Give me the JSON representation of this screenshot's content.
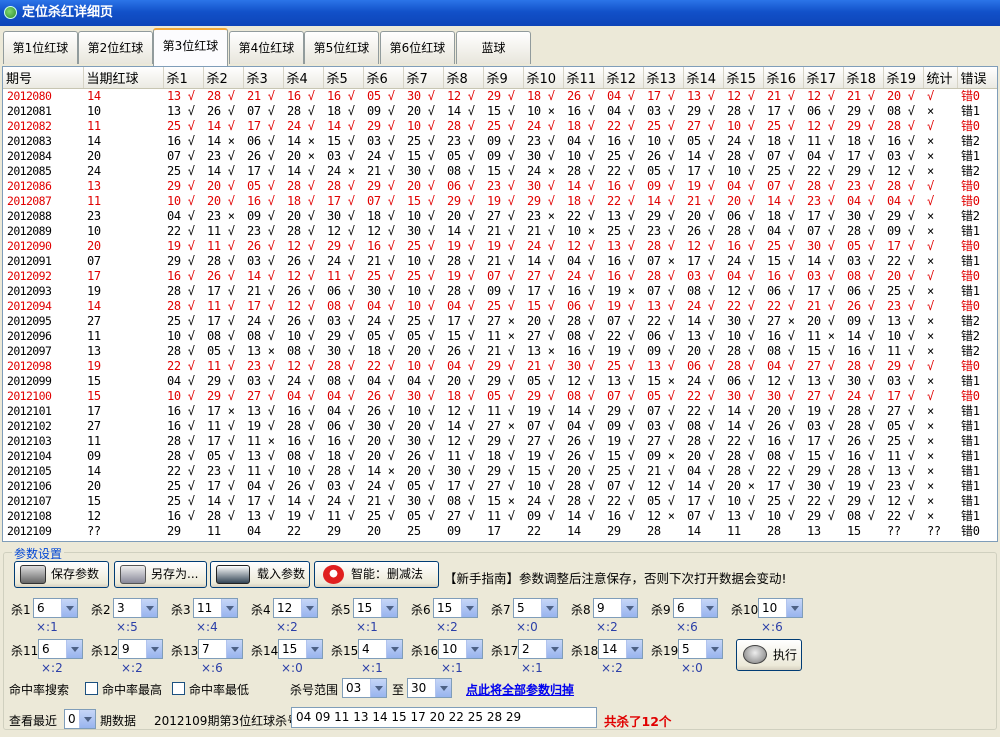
{
  "window": {
    "title": "定位杀红详细页"
  },
  "tabs": [
    "第1位红球",
    "第2位红球",
    "第3位红球",
    "第4位红球",
    "第5位红球",
    "第6位红球",
    "蓝球"
  ],
  "active_tab": 2,
  "table": {
    "headers": [
      "期号",
      "当期红球",
      "杀1",
      "杀2",
      "杀3",
      "杀4",
      "杀5",
      "杀6",
      "杀7",
      "杀8",
      "杀9",
      "杀10",
      "杀11",
      "杀12",
      "杀13",
      "杀14",
      "杀15",
      "杀16",
      "杀17",
      "杀18",
      "杀19",
      "统计",
      "错误"
    ],
    "rows": [
      {
        "red": true,
        "cells": [
          "2012080",
          "14",
          "13 √",
          "28 √",
          "21 √",
          "16 √",
          "16 √",
          "05 √",
          "30 √",
          "12 √",
          "29 √",
          "18 √",
          "26 √",
          "04 √",
          "17 √",
          "13 √",
          "12 √",
          "21 √",
          "12 √",
          "21 √",
          "20 √",
          "√",
          "错0"
        ]
      },
      {
        "red": false,
        "cells": [
          "2012081",
          "10",
          "13 √",
          "26 √",
          "07 √",
          "28 √",
          "18 √",
          "09 √",
          "20 √",
          "14 √",
          "15 √",
          "10 ×",
          "16 √",
          "04 √",
          "03 √",
          "29 √",
          "28 √",
          "17 √",
          "06 √",
          "29 √",
          "08 √",
          "×",
          "错1"
        ]
      },
      {
        "red": true,
        "cells": [
          "2012082",
          "11",
          "25 √",
          "14 √",
          "17 √",
          "24 √",
          "14 √",
          "29 √",
          "10 √",
          "28 √",
          "25 √",
          "24 √",
          "18 √",
          "22 √",
          "25 √",
          "27 √",
          "10 √",
          "25 √",
          "12 √",
          "29 √",
          "28 √",
          "√",
          "错0"
        ]
      },
      {
        "red": false,
        "cells": [
          "2012083",
          "14",
          "16 √",
          "14 ×",
          "06 √",
          "14 ×",
          "15 √",
          "03 √",
          "25 √",
          "23 √",
          "09 √",
          "23 √",
          "04 √",
          "16 √",
          "10 √",
          "05 √",
          "24 √",
          "18 √",
          "11 √",
          "18 √",
          "16 √",
          "×",
          "错2"
        ]
      },
      {
        "red": false,
        "cells": [
          "2012084",
          "20",
          "07 √",
          "23 √",
          "26 √",
          "20 ×",
          "03 √",
          "24 √",
          "15 √",
          "05 √",
          "09 √",
          "30 √",
          "10 √",
          "25 √",
          "26 √",
          "14 √",
          "28 √",
          "07 √",
          "04 √",
          "17 √",
          "03 √",
          "×",
          "错1"
        ]
      },
      {
        "red": false,
        "cells": [
          "2012085",
          "24",
          "25 √",
          "14 √",
          "17 √",
          "14 √",
          "24 ×",
          "21 √",
          "30 √",
          "08 √",
          "15 √",
          "24 ×",
          "28 √",
          "22 √",
          "05 √",
          "17 √",
          "10 √",
          "25 √",
          "22 √",
          "29 √",
          "12 √",
          "×",
          "错2"
        ]
      },
      {
        "red": true,
        "cells": [
          "2012086",
          "13",
          "29 √",
          "20 √",
          "05 √",
          "28 √",
          "28 √",
          "29 √",
          "20 √",
          "06 √",
          "23 √",
          "30 √",
          "14 √",
          "16 √",
          "09 √",
          "19 √",
          "04 √",
          "07 √",
          "28 √",
          "23 √",
          "28 √",
          "√",
          "错0"
        ]
      },
      {
        "red": true,
        "cells": [
          "2012087",
          "11",
          "10 √",
          "20 √",
          "16 √",
          "18 √",
          "17 √",
          "07 √",
          "15 √",
          "29 √",
          "19 √",
          "29 √",
          "18 √",
          "22 √",
          "14 √",
          "21 √",
          "20 √",
          "14 √",
          "23 √",
          "04 √",
          "04 √",
          "√",
          "错0"
        ]
      },
      {
        "red": false,
        "cells": [
          "2012088",
          "23",
          "04 √",
          "23 ×",
          "09 √",
          "20 √",
          "30 √",
          "18 √",
          "10 √",
          "20 √",
          "27 √",
          "23 ×",
          "22 √",
          "13 √",
          "29 √",
          "20 √",
          "06 √",
          "18 √",
          "17 √",
          "30 √",
          "29 √",
          "×",
          "错2"
        ]
      },
      {
        "red": false,
        "cells": [
          "2012089",
          "10",
          "22 √",
          "11 √",
          "23 √",
          "28 √",
          "12 √",
          "12 √",
          "30 √",
          "14 √",
          "21 √",
          "21 √",
          "10 ×",
          "25 √",
          "23 √",
          "26 √",
          "28 √",
          "04 √",
          "07 √",
          "28 √",
          "09 √",
          "×",
          "错1"
        ]
      },
      {
        "red": true,
        "cells": [
          "2012090",
          "20",
          "19 √",
          "11 √",
          "26 √",
          "12 √",
          "29 √",
          "16 √",
          "25 √",
          "19 √",
          "19 √",
          "24 √",
          "12 √",
          "13 √",
          "28 √",
          "12 √",
          "16 √",
          "25 √",
          "30 √",
          "05 √",
          "17 √",
          "√",
          "错0"
        ]
      },
      {
        "red": false,
        "cells": [
          "2012091",
          "07",
          "29 √",
          "28 √",
          "03 √",
          "26 √",
          "24 √",
          "21 √",
          "10 √",
          "28 √",
          "21 √",
          "14 √",
          "04 √",
          "16 √",
          "07 ×",
          "17 √",
          "24 √",
          "15 √",
          "14 √",
          "03 √",
          "22 √",
          "×",
          "错1"
        ]
      },
      {
        "red": true,
        "cells": [
          "2012092",
          "17",
          "16 √",
          "26 √",
          "14 √",
          "12 √",
          "11 √",
          "25 √",
          "25 √",
          "19 √",
          "07 √",
          "27 √",
          "24 √",
          "16 √",
          "28 √",
          "03 √",
          "04 √",
          "16 √",
          "03 √",
          "08 √",
          "20 √",
          "√",
          "错0"
        ]
      },
      {
        "red": false,
        "cells": [
          "2012093",
          "19",
          "28 √",
          "17 √",
          "21 √",
          "26 √",
          "06 √",
          "30 √",
          "10 √",
          "28 √",
          "09 √",
          "17 √",
          "16 √",
          "19 ×",
          "07 √",
          "08 √",
          "12 √",
          "06 √",
          "17 √",
          "06 √",
          "25 √",
          "×",
          "错1"
        ]
      },
      {
        "red": true,
        "cells": [
          "2012094",
          "14",
          "28 √",
          "11 √",
          "17 √",
          "12 √",
          "08 √",
          "04 √",
          "10 √",
          "04 √",
          "25 √",
          "15 √",
          "06 √",
          "19 √",
          "13 √",
          "24 √",
          "22 √",
          "22 √",
          "21 √",
          "26 √",
          "23 √",
          "√",
          "错0"
        ]
      },
      {
        "red": false,
        "cells": [
          "2012095",
          "27",
          "25 √",
          "17 √",
          "24 √",
          "26 √",
          "03 √",
          "24 √",
          "25 √",
          "17 √",
          "27 ×",
          "20 √",
          "28 √",
          "07 √",
          "22 √",
          "14 √",
          "30 √",
          "27 ×",
          "20 √",
          "09 √",
          "13 √",
          "×",
          "错2"
        ]
      },
      {
        "red": false,
        "cells": [
          "2012096",
          "11",
          "10 √",
          "08 √",
          "08 √",
          "10 √",
          "29 √",
          "05 √",
          "05 √",
          "15 √",
          "11 ×",
          "27 √",
          "08 √",
          "22 √",
          "06 √",
          "13 √",
          "10 √",
          "16 √",
          "11 ×",
          "14 √",
          "10 √",
          "×",
          "错2"
        ]
      },
      {
        "red": false,
        "cells": [
          "2012097",
          "13",
          "28 √",
          "05 √",
          "13 ×",
          "08 √",
          "30 √",
          "18 √",
          "20 √",
          "26 √",
          "21 √",
          "13 ×",
          "16 √",
          "19 √",
          "09 √",
          "20 √",
          "28 √",
          "08 √",
          "15 √",
          "16 √",
          "11 √",
          "×",
          "错2"
        ]
      },
      {
        "red": true,
        "cells": [
          "2012098",
          "19",
          "22 √",
          "11 √",
          "23 √",
          "12 √",
          "28 √",
          "22 √",
          "10 √",
          "04 √",
          "29 √",
          "21 √",
          "30 √",
          "25 √",
          "13 √",
          "06 √",
          "28 √",
          "04 √",
          "27 √",
          "28 √",
          "29 √",
          "√",
          "错0"
        ]
      },
      {
        "red": false,
        "cells": [
          "2012099",
          "15",
          "04 √",
          "29 √",
          "03 √",
          "24 √",
          "08 √",
          "04 √",
          "04 √",
          "20 √",
          "29 √",
          "05 √",
          "12 √",
          "13 √",
          "15 ×",
          "24 √",
          "06 √",
          "12 √",
          "13 √",
          "30 √",
          "03 √",
          "×",
          "错1"
        ]
      },
      {
        "red": true,
        "cells": [
          "2012100",
          "15",
          "10 √",
          "29 √",
          "27 √",
          "04 √",
          "04 √",
          "26 √",
          "30 √",
          "18 √",
          "05 √",
          "29 √",
          "08 √",
          "07 √",
          "05 √",
          "22 √",
          "30 √",
          "30 √",
          "27 √",
          "24 √",
          "17 √",
          "√",
          "错0"
        ]
      },
      {
        "red": false,
        "cells": [
          "2012101",
          "17",
          "16 √",
          "17 ×",
          "13 √",
          "16 √",
          "04 √",
          "26 √",
          "10 √",
          "12 √",
          "11 √",
          "19 √",
          "14 √",
          "29 √",
          "07 √",
          "22 √",
          "14 √",
          "20 √",
          "19 √",
          "28 √",
          "27 √",
          "×",
          "错1"
        ]
      },
      {
        "red": false,
        "cells": [
          "2012102",
          "27",
          "16 √",
          "11 √",
          "19 √",
          "28 √",
          "06 √",
          "30 √",
          "20 √",
          "14 √",
          "27 ×",
          "07 √",
          "04 √",
          "09 √",
          "03 √",
          "08 √",
          "14 √",
          "26 √",
          "03 √",
          "28 √",
          "05 √",
          "×",
          "错1"
        ]
      },
      {
        "red": false,
        "cells": [
          "2012103",
          "11",
          "28 √",
          "17 √",
          "11 ×",
          "16 √",
          "16 √",
          "20 √",
          "30 √",
          "12 √",
          "29 √",
          "27 √",
          "26 √",
          "19 √",
          "27 √",
          "28 √",
          "22 √",
          "16 √",
          "17 √",
          "26 √",
          "25 √",
          "×",
          "错1"
        ]
      },
      {
        "red": false,
        "cells": [
          "2012104",
          "09",
          "28 √",
          "05 √",
          "13 √",
          "08 √",
          "18 √",
          "20 √",
          "26 √",
          "11 √",
          "18 √",
          "19 √",
          "26 √",
          "15 √",
          "09 ×",
          "20 √",
          "28 √",
          "08 √",
          "15 √",
          "16 √",
          "11 √",
          "×",
          "错1"
        ]
      },
      {
        "red": false,
        "cells": [
          "2012105",
          "14",
          "22 √",
          "23 √",
          "11 √",
          "10 √",
          "28 √",
          "14 ×",
          "20 √",
          "30 √",
          "29 √",
          "15 √",
          "20 √",
          "25 √",
          "21 √",
          "04 √",
          "28 √",
          "22 √",
          "29 √",
          "28 √",
          "13 √",
          "×",
          "错1"
        ]
      },
      {
        "red": false,
        "cells": [
          "2012106",
          "20",
          "25 √",
          "17 √",
          "04 √",
          "26 √",
          "03 √",
          "24 √",
          "05 √",
          "17 √",
          "27 √",
          "10 √",
          "28 √",
          "07 √",
          "12 √",
          "14 √",
          "20 ×",
          "17 √",
          "30 √",
          "19 √",
          "23 √",
          "×",
          "错1"
        ]
      },
      {
        "red": false,
        "cells": [
          "2012107",
          "15",
          "25 √",
          "14 √",
          "17 √",
          "14 √",
          "24 √",
          "21 √",
          "30 √",
          "08 √",
          "15 ×",
          "24 √",
          "28 √",
          "22 √",
          "05 √",
          "17 √",
          "10 √",
          "25 √",
          "22 √",
          "29 √",
          "12 √",
          "×",
          "错1"
        ]
      },
      {
        "red": false,
        "cells": [
          "2012108",
          "12",
          "16 √",
          "28 √",
          "13 √",
          "19 √",
          "11 √",
          "25 √",
          "05 √",
          "27 √",
          "11 √",
          "09 √",
          "14 √",
          "16 √",
          "12 ×",
          "07 √",
          "13 √",
          "10 √",
          "29 √",
          "08 √",
          "22 √",
          "×",
          "错1"
        ]
      },
      {
        "red": false,
        "cells": [
          "2012109",
          "??",
          "29",
          "11",
          "04",
          "22",
          "29",
          "20",
          "25",
          "09",
          "17",
          "22",
          "14",
          "29",
          "28",
          "14",
          "11",
          "28",
          "13",
          "15",
          "??",
          "??",
          "错0"
        ]
      }
    ]
  },
  "params": {
    "legend": "参数设置",
    "buttons": {
      "save": "保存参数",
      "save_as": "另存为...",
      "load": "载入参数",
      "smart": "智能：删减法",
      "run": "执行"
    },
    "tip": "【新手指南】参数调整后注意保存，否则下次打开数据会变动!",
    "kills": [
      {
        "label": "杀1",
        "value": "6",
        "ratio": "×:1"
      },
      {
        "label": "杀2",
        "value": "3",
        "ratio": "×:5"
      },
      {
        "label": "杀3",
        "value": "11",
        "ratio": "×:4"
      },
      {
        "label": "杀4",
        "value": "12",
        "ratio": "×:2"
      },
      {
        "label": "杀5",
        "value": "15",
        "ratio": "×:1"
      },
      {
        "label": "杀6",
        "value": "15",
        "ratio": "×:2"
      },
      {
        "label": "杀7",
        "value": "5",
        "ratio": "×:0"
      },
      {
        "label": "杀8",
        "value": "9",
        "ratio": "×:2"
      },
      {
        "label": "杀9",
        "value": "6",
        "ratio": "×:6"
      },
      {
        "label": "杀10",
        "value": "10",
        "ratio": "×:6"
      },
      {
        "label": "杀11",
        "value": "6",
        "ratio": "×:2"
      },
      {
        "label": "杀12",
        "value": "9",
        "ratio": "×:2"
      },
      {
        "label": "杀13",
        "value": "7",
        "ratio": "×:6"
      },
      {
        "label": "杀14",
        "value": "15",
        "ratio": "×:0"
      },
      {
        "label": "杀15",
        "value": "4",
        "ratio": "×:1"
      },
      {
        "label": "杀16",
        "value": "10",
        "ratio": "×:1"
      },
      {
        "label": "杀17",
        "value": "2",
        "ratio": "×:1"
      },
      {
        "label": "杀18",
        "value": "14",
        "ratio": "×:2"
      },
      {
        "label": "杀19",
        "value": "5",
        "ratio": "×:0"
      }
    ],
    "search_label": "命中率搜索",
    "chk_high": "命中率最高",
    "chk_low": "命中率最低",
    "range_label": "杀号范围",
    "range_from": "03",
    "range_to_label": "至",
    "range_to": "30",
    "reset_link": "点此将全部参数归掉",
    "recent_label": "查看最近",
    "recent_value": "0",
    "recent_suffix": "期数据",
    "result_label": "2012109期第3位红球杀号",
    "result_value": "04 09 11 13 14 15 17 20 22 25 28 29",
    "result_count": "共杀了12个"
  }
}
